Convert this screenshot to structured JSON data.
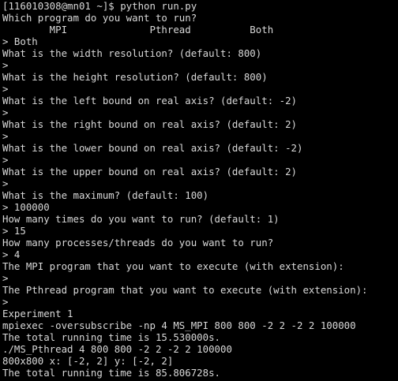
{
  "terminal": {
    "lines": [
      "[116010308@mn01 ~]$ python run.py",
      "Which program do you want to run?",
      "        MPI              Pthread          Both",
      "> Both",
      "What is the width resolution? (default: 800)",
      ">",
      "What is the height resolution? (default: 800)",
      ">",
      "What is the left bound on real axis? (default: -2)",
      ">",
      "What is the right bound on real axis? (default: 2)",
      ">",
      "What is the lower bound on real axis? (default: -2)",
      ">",
      "What is the upper bound on real axis? (default: 2)",
      ">",
      "What is the maximum? (default: 100)",
      "> 100000",
      "How many times do you want to run? (default: 1)",
      "> 15",
      "How many processes/threads do you want to run?",
      "> 4",
      "The MPI program that you want to execute (with extension):",
      ">",
      "The Pthread program that you want to execute (with extension):",
      ">",
      "Experiment 1",
      "mpiexec -oversubscribe -np 4 MS_MPI 800 800 -2 2 -2 2 100000",
      "The total running time is 15.530000s.",
      "./MS_Pthread 4 800 800 -2 2 -2 2 100000",
      "800x800 x: [-2, 2] y: [-2, 2]",
      "The total running time is 85.806728s."
    ]
  },
  "colors": {
    "background": "#000000",
    "foreground": "#d8d8d8"
  }
}
